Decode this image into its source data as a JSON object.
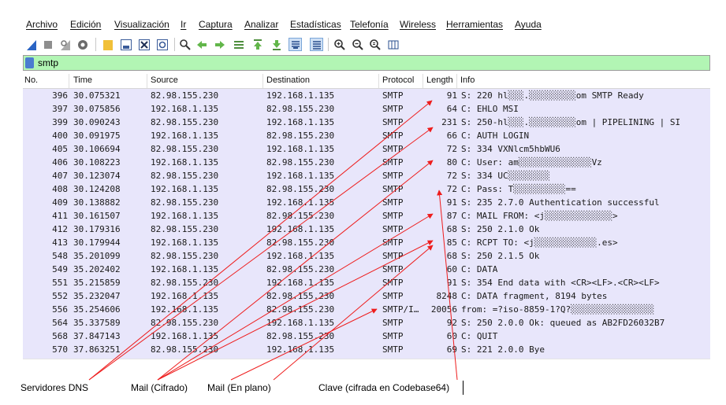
{
  "menubar": {
    "items": [
      "Archivo",
      "Edición",
      "Visualización",
      "Ir",
      "Captura",
      "Analizar",
      "Estadísticas",
      "Telefonía",
      "Wireless",
      "Herramientas",
      "Ayuda"
    ]
  },
  "toolbar": {
    "icons": [
      "shark-fin-start-icon",
      "stop-square-icon",
      "shark-fin-restart-icon",
      "capture-options-gear-icon",
      "open-folder-icon",
      "save-file-icon",
      "close-file-icon",
      "reload-file-icon",
      "find-packet-icon",
      "go-back-icon",
      "go-forward-icon",
      "go-to-packet-icon",
      "go-first-icon",
      "go-last-icon",
      "autoscroll-icon",
      "colorize-icon",
      "zoom-in-icon",
      "zoom-out-icon",
      "zoom-reset-icon",
      "resize-columns-icon"
    ]
  },
  "filter": {
    "value": "smtp"
  },
  "columns": {
    "no": "No.",
    "time": "Time",
    "source": "Source",
    "destination": "Destination",
    "protocol": "Protocol",
    "length": "Length",
    "info": "Info"
  },
  "packets": [
    {
      "no": "396",
      "time": "30.075321",
      "source": "82.98.155.230",
      "destination": "192.168.1.135",
      "protocol": "SMTP",
      "length": "91",
      "info": "S: 220 hl░░░.░░░░░░░░░om SMTP Ready"
    },
    {
      "no": "397",
      "time": "30.075856",
      "source": "192.168.1.135",
      "destination": "82.98.155.230",
      "protocol": "SMTP",
      "length": "64",
      "info": "C: EHLO MSI"
    },
    {
      "no": "399",
      "time": "30.090243",
      "source": "82.98.155.230",
      "destination": "192.168.1.135",
      "protocol": "SMTP",
      "length": "231",
      "info": "S: 250-hl░░░.░░░░░░░░░om | PIPELINING | SI"
    },
    {
      "no": "400",
      "time": "30.091975",
      "source": "192.168.1.135",
      "destination": "82.98.155.230",
      "protocol": "SMTP",
      "length": "66",
      "info": "C: AUTH LOGIN"
    },
    {
      "no": "405",
      "time": "30.106694",
      "source": "82.98.155.230",
      "destination": "192.168.1.135",
      "protocol": "SMTP",
      "length": "72",
      "info": "S: 334 VXNlcm5hbWU6"
    },
    {
      "no": "406",
      "time": "30.108223",
      "source": "192.168.1.135",
      "destination": "82.98.155.230",
      "protocol": "SMTP",
      "length": "80",
      "info": "C: User: am░░░░░░░░░░░░░░Vz"
    },
    {
      "no": "407",
      "time": "30.123074",
      "source": "82.98.155.230",
      "destination": "192.168.1.135",
      "protocol": "SMTP",
      "length": "72",
      "info": "S: 334 UC░░░░░░░░"
    },
    {
      "no": "408",
      "time": "30.124208",
      "source": "192.168.1.135",
      "destination": "82.98.155.230",
      "protocol": "SMTP",
      "length": "72",
      "info": "C: Pass: T░░░░░░░░░░=="
    },
    {
      "no": "409",
      "time": "30.138882",
      "source": "82.98.155.230",
      "destination": "192.168.1.135",
      "protocol": "SMTP",
      "length": "91",
      "info": "S: 235 2.7.0 Authentication successful"
    },
    {
      "no": "411",
      "time": "30.161507",
      "source": "192.168.1.135",
      "destination": "82.98.155.230",
      "protocol": "SMTP",
      "length": "87",
      "info": "C: MAIL FROM: <j░░░░░░░░░░░░░>"
    },
    {
      "no": "412",
      "time": "30.179316",
      "source": "82.98.155.230",
      "destination": "192.168.1.135",
      "protocol": "SMTP",
      "length": "68",
      "info": "S: 250 2.1.0 Ok"
    },
    {
      "no": "413",
      "time": "30.179944",
      "source": "192.168.1.135",
      "destination": "82.98.155.230",
      "protocol": "SMTP",
      "length": "85",
      "info": "C: RCPT TO: <j░░░░░░░░░░░░.es>"
    },
    {
      "no": "548",
      "time": "35.201099",
      "source": "82.98.155.230",
      "destination": "192.168.1.135",
      "protocol": "SMTP",
      "length": "68",
      "info": "S: 250 2.1.5 Ok"
    },
    {
      "no": "549",
      "time": "35.202402",
      "source": "192.168.1.135",
      "destination": "82.98.155.230",
      "protocol": "SMTP",
      "length": "60",
      "info": "C: DATA"
    },
    {
      "no": "551",
      "time": "35.215859",
      "source": "82.98.155.230",
      "destination": "192.168.1.135",
      "protocol": "SMTP",
      "length": "91",
      "info": "S: 354 End data with <CR><LF>.<CR><LF>"
    },
    {
      "no": "552",
      "time": "35.232047",
      "source": "192.168.1.135",
      "destination": "82.98.155.230",
      "protocol": "SMTP",
      "length": "8248",
      "info": "C: DATA fragment, 8194 bytes"
    },
    {
      "no": "556",
      "time": "35.254606",
      "source": "192.168.1.135",
      "destination": "82.98.155.230",
      "protocol": "SMTP/I…",
      "length": "20056",
      "info": "from: =?iso-8859-1?Q?░░░░░░░░░░░░░░░░"
    },
    {
      "no": "564",
      "time": "35.337589",
      "source": "82.98.155.230",
      "destination": "192.168.1.135",
      "protocol": "SMTP",
      "length": "92",
      "info": "S: 250 2.0.0 Ok: queued as AB2FD26032B7"
    },
    {
      "no": "568",
      "time": "37.847143",
      "source": "192.168.1.135",
      "destination": "82.98.155.230",
      "protocol": "SMTP",
      "length": "60",
      "info": "C: QUIT"
    },
    {
      "no": "570",
      "time": "37.863251",
      "source": "82.98.155.230",
      "destination": "192.168.1.135",
      "protocol": "SMTP",
      "length": "69",
      "info": "S: 221 2.0.0 Bye"
    }
  ],
  "annotations": {
    "dns_servers": "Servidores DNS",
    "mail_encrypted": "Mail (Cifrado)",
    "mail_plain": "Mail (En plano)",
    "password_base64": "Clave (cifrada en Codebase64)"
  },
  "colors": {
    "row_background": "#e8e6fb",
    "filter_valid": "#b2f5b4",
    "annotation_arrow": "#ee1c1c"
  }
}
